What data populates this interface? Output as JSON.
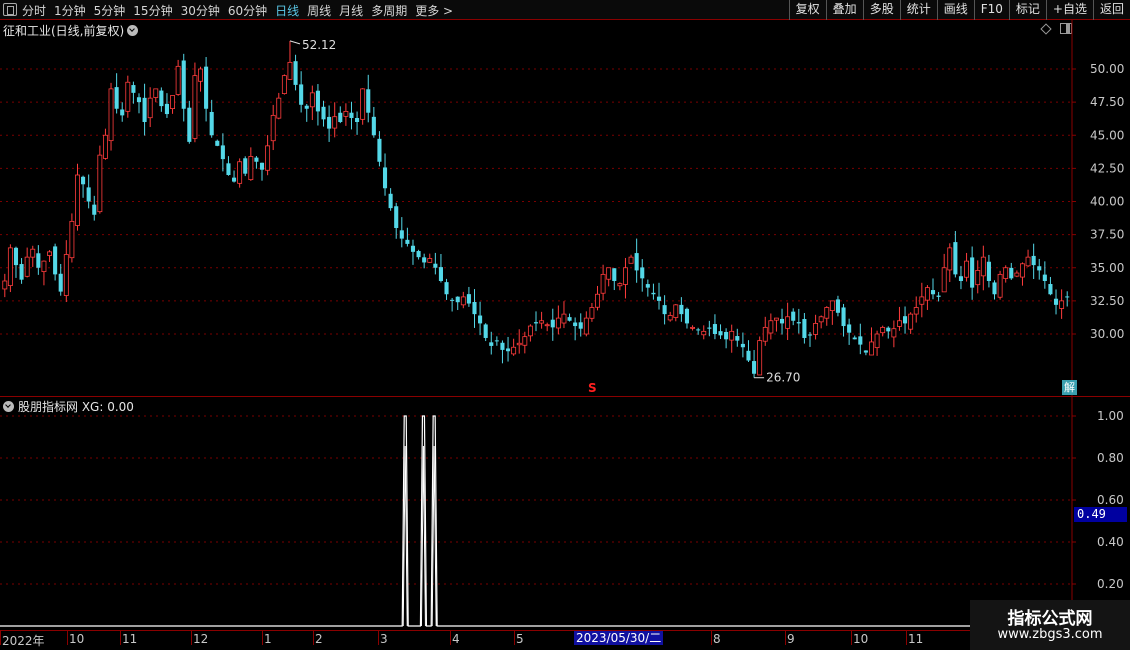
{
  "toolbar": {
    "periods": [
      {
        "label": "分时",
        "active": false
      },
      {
        "label": "1分钟",
        "active": false
      },
      {
        "label": "5分钟",
        "active": false
      },
      {
        "label": "15分钟",
        "active": false
      },
      {
        "label": "30分钟",
        "active": false
      },
      {
        "label": "60分钟",
        "active": false
      },
      {
        "label": "日线",
        "active": true
      },
      {
        "label": "周线",
        "active": false
      },
      {
        "label": "月线",
        "active": false
      },
      {
        "label": "多周期",
        "active": false
      },
      {
        "label": "更多 >",
        "active": false
      }
    ],
    "right_buttons": [
      "复权",
      "叠加",
      "多股",
      "统计",
      "画线",
      "F10",
      "标记",
      "+自选",
      "返回"
    ]
  },
  "main_pane": {
    "title": "征和工业(日线,前复权)",
    "high_label": "52.12",
    "low_label": "26.70",
    "s_marker": "S",
    "jie_label": "解",
    "price_ticks": [
      "50.00",
      "47.50",
      "45.00",
      "42.50",
      "40.00",
      "37.50",
      "35.00",
      "32.50",
      "30.00"
    ]
  },
  "sub_pane": {
    "title": "股朋指标网 XG: 0.00",
    "ticks": [
      "1.00",
      "0.80",
      "0.60",
      "0.40",
      "0.20"
    ],
    "current_value": "0.49"
  },
  "date_axis": {
    "labels": [
      "2022年",
      "10",
      "11",
      "12",
      "1",
      "2",
      "3",
      "4",
      "5",
      "8",
      "9",
      "10",
      "11"
    ],
    "highlight": "2023/05/30/二"
  },
  "watermark": {
    "line1": "指标公式网",
    "line2": "www.zbgs3.com"
  },
  "colors": {
    "up": "#ff3c3c",
    "down": "#54d8e8",
    "grid": "#7a0000",
    "axis_text": "#c8c8c8",
    "active_tab": "#5bc8e8"
  },
  "chart_data": {
    "type": "candlestick",
    "symbol": "征和工业",
    "ylim": [
      25,
      52.12
    ],
    "high": 52.12,
    "low": 26.7,
    "close_path": [
      34.0,
      36.5,
      35.2,
      34.1,
      35.8,
      36.4,
      35.0,
      35.5,
      36.2,
      34.5,
      33.2,
      36.0,
      38.5,
      42.0,
      41.3,
      40.0,
      39.0,
      43.5,
      45.0,
      48.5,
      47.0,
      46.5,
      49.0,
      48.2,
      47.5,
      46.0,
      47.8,
      48.5,
      47.2,
      46.6,
      48.0,
      50.2,
      47.0,
      44.5,
      49.5,
      50.0,
      47.0,
      45.0,
      44.2,
      43.2,
      42.0,
      41.5,
      43.0,
      42.1,
      43.4,
      43.0,
      42.4,
      44.2,
      46.5,
      47.8,
      49.5,
      50.5,
      48.8,
      47.3,
      47.0,
      48.2,
      46.8,
      46.2,
      45.5,
      46.4,
      46.0,
      46.8,
      46.3,
      46.0,
      48.5,
      46.7,
      45.0,
      43.0,
      41.0,
      39.5,
      38.0,
      37.2,
      36.8,
      36.2,
      35.8,
      35.4,
      35.7,
      35.0,
      34.0,
      33.0,
      32.5,
      32.4,
      32.8,
      32.3,
      31.5,
      30.8,
      29.7,
      29.1,
      29.5,
      28.8,
      28.7,
      29.0,
      29.3,
      29.8,
      30.6,
      30.8,
      31.0,
      30.7,
      30.5,
      31.2,
      31.5,
      31.0,
      30.6,
      30.4,
      31.2,
      32.0,
      33.0,
      34.5,
      35.0,
      34.0,
      33.8,
      35.0,
      35.8,
      34.8,
      34.2,
      33.5,
      33.0,
      32.5,
      31.5,
      31.4,
      32.2,
      31.5,
      30.8,
      30.5,
      30.3,
      30.2,
      30.4,
      30.0,
      29.9,
      29.6,
      30.2,
      29.5,
      29.0,
      28.0,
      27.0,
      29.5,
      30.5,
      31.0,
      31.2,
      30.8,
      31.3,
      31.0,
      30.8,
      29.7,
      29.9,
      30.8,
      31.3,
      32.0,
      32.5,
      31.6,
      30.6,
      30.1,
      29.6,
      29.2,
      28.6,
      29.4,
      30.0,
      30.5,
      30.2,
      30.4,
      31.0,
      30.8,
      31.5,
      32.0,
      32.8,
      33.5,
      33.0,
      32.8,
      35.0,
      36.5,
      34.5,
      34.0,
      35.5,
      33.5,
      34.8,
      35.8,
      34.0,
      33.0,
      34.5,
      35.0,
      34.2,
      34.6,
      35.3,
      35.8,
      35.2,
      34.8,
      34.0,
      33.0,
      32.2,
      32.5,
      32.8
    ],
    "xg_signal": {
      "ylim": [
        0,
        1
      ],
      "pulses_at_bar_fraction": [
        0.378,
        0.395,
        0.405
      ]
    }
  }
}
